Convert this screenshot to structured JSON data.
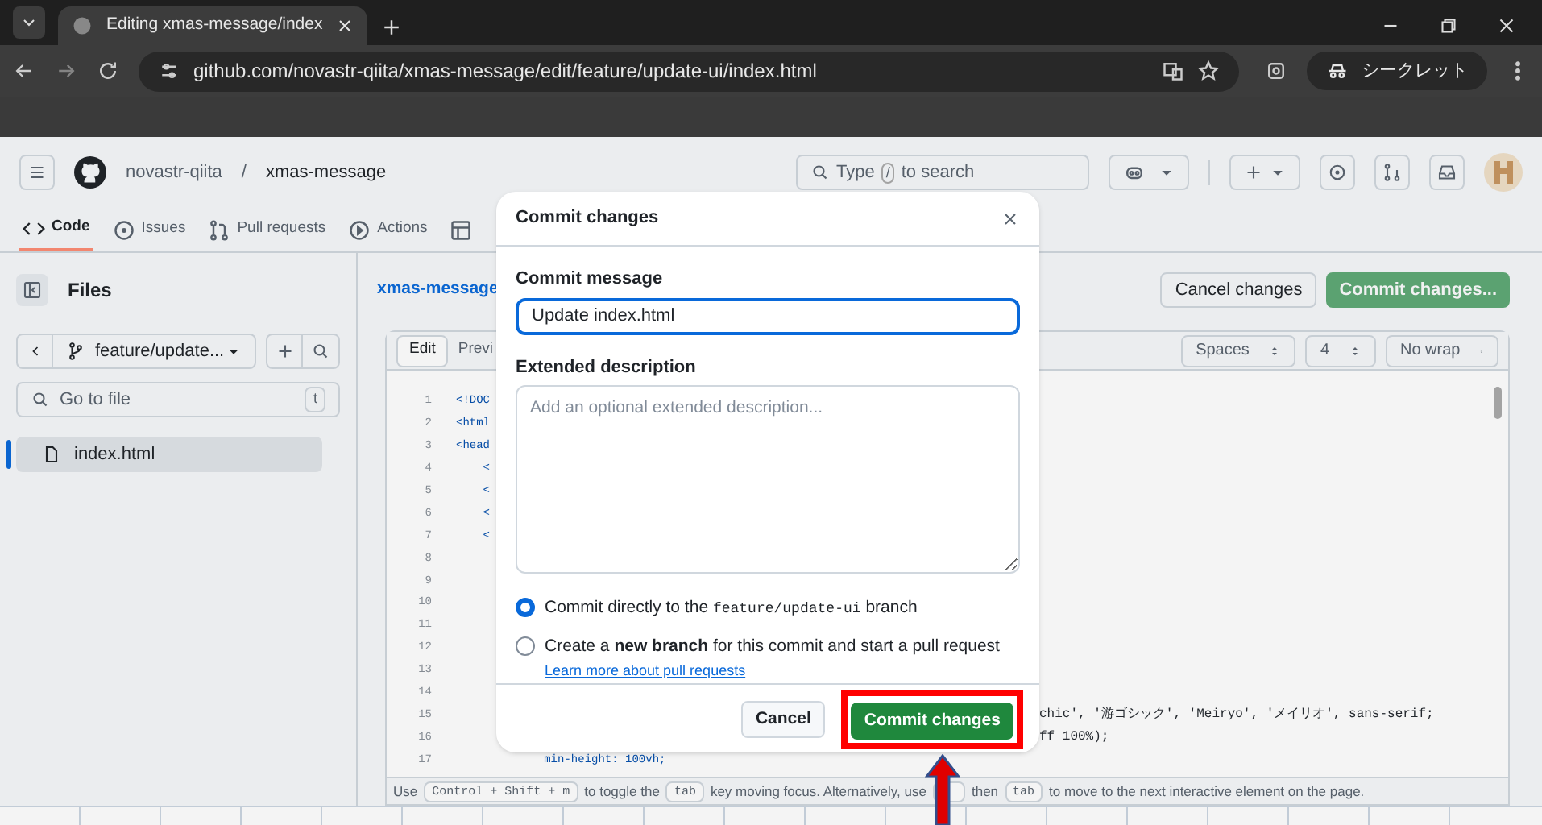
{
  "browser": {
    "tab_title": "Editing xmas-message/index",
    "url": "github.com/novastr-qiita/xmas-message/edit/feature/update-ui/index.html",
    "profile": "シークレット"
  },
  "header": {
    "owner": "novastr-qiita",
    "separator": "/",
    "repo": "xmas-message",
    "search": {
      "placeholder_before": "Type",
      "key": "/",
      "placeholder_after": "to search"
    }
  },
  "repo_nav": [
    {
      "label": "Code",
      "selected": true
    },
    {
      "label": "Issues",
      "selected": false
    },
    {
      "label": "Pull requests",
      "selected": false
    },
    {
      "label": "Actions",
      "selected": false
    },
    {
      "selected": false
    }
  ],
  "sidebar": {
    "title": "Files",
    "branch": "feature/update...",
    "go_to_file": {
      "placeholder": "Go to file",
      "key": "t"
    },
    "files": [
      {
        "name": "index.html",
        "selected": true
      }
    ]
  },
  "breadcrumb": "xmas-message",
  "actions": {
    "cancel": "Cancel changes",
    "commit": "Commit changes..."
  },
  "editor": {
    "tabs": [
      {
        "label": "Edit",
        "selected": true
      },
      {
        "label": "Previ",
        "selected": false
      }
    ],
    "selects": [
      "Spaces",
      "4",
      "No wrap"
    ],
    "lines": [
      {
        "number": "1",
        "left": "<!DOC"
      },
      {
        "number": "2",
        "left": "<html"
      },
      {
        "number": "3",
        "left": "<head"
      },
      {
        "number": "4",
        "left": "    <"
      },
      {
        "number": "5",
        "left": "    <"
      },
      {
        "number": "6",
        "left": "    <"
      },
      {
        "number": "7",
        "left": "    <"
      },
      {
        "number": "8"
      },
      {
        "number": "9"
      },
      {
        "number": "10"
      },
      {
        "number": "11"
      },
      {
        "number": "12"
      },
      {
        "number": "13"
      },
      {
        "number": "14"
      },
      {
        "number": "15",
        "right": "chic', '游ゴシック', 'Meiryo', 'メイリオ', sans-serif;"
      },
      {
        "number": "16",
        "right": "ff 100%);"
      },
      {
        "number": "17",
        "left": "             min-height: 100vh;"
      }
    ],
    "hint": [
      {
        "kind": "text",
        "text": "Use"
      },
      {
        "kind": "key",
        "text": "Control + Shift + m"
      },
      {
        "kind": "text",
        "text": "to toggle the"
      },
      {
        "kind": "key",
        "text": "tab"
      },
      {
        "kind": "text",
        "text": "key moving focus. Alternatively, use"
      },
      {
        "kind": "hidden_key"
      },
      {
        "kind": "text",
        "text": "then"
      },
      {
        "kind": "key",
        "text": "tab"
      },
      {
        "kind": "text",
        "text": "to move to the next interactive element on the page."
      }
    ]
  },
  "dialog": {
    "title": "Commit changes",
    "message_label": "Commit message",
    "message": "Update index.html",
    "description_label": "Extended description",
    "description_placeholder": "Add an optional extended description...",
    "options": [
      {
        "selected": true,
        "parts": [
          {
            "kind": "text",
            "text": "Commit directly to the"
          },
          {
            "kind": "code",
            "text": "feature/update-ui"
          },
          {
            "kind": "text",
            "text": "branch"
          }
        ]
      },
      {
        "selected": false,
        "parts": [
          {
            "kind": "text",
            "text": "Create a **new branch** for this commit and start a pull request"
          },
          {
            "kind": "link",
            "text": "Learn more about pull requests"
          }
        ]
      }
    ],
    "cancel": "Cancel",
    "commit": "Commit changes"
  }
}
